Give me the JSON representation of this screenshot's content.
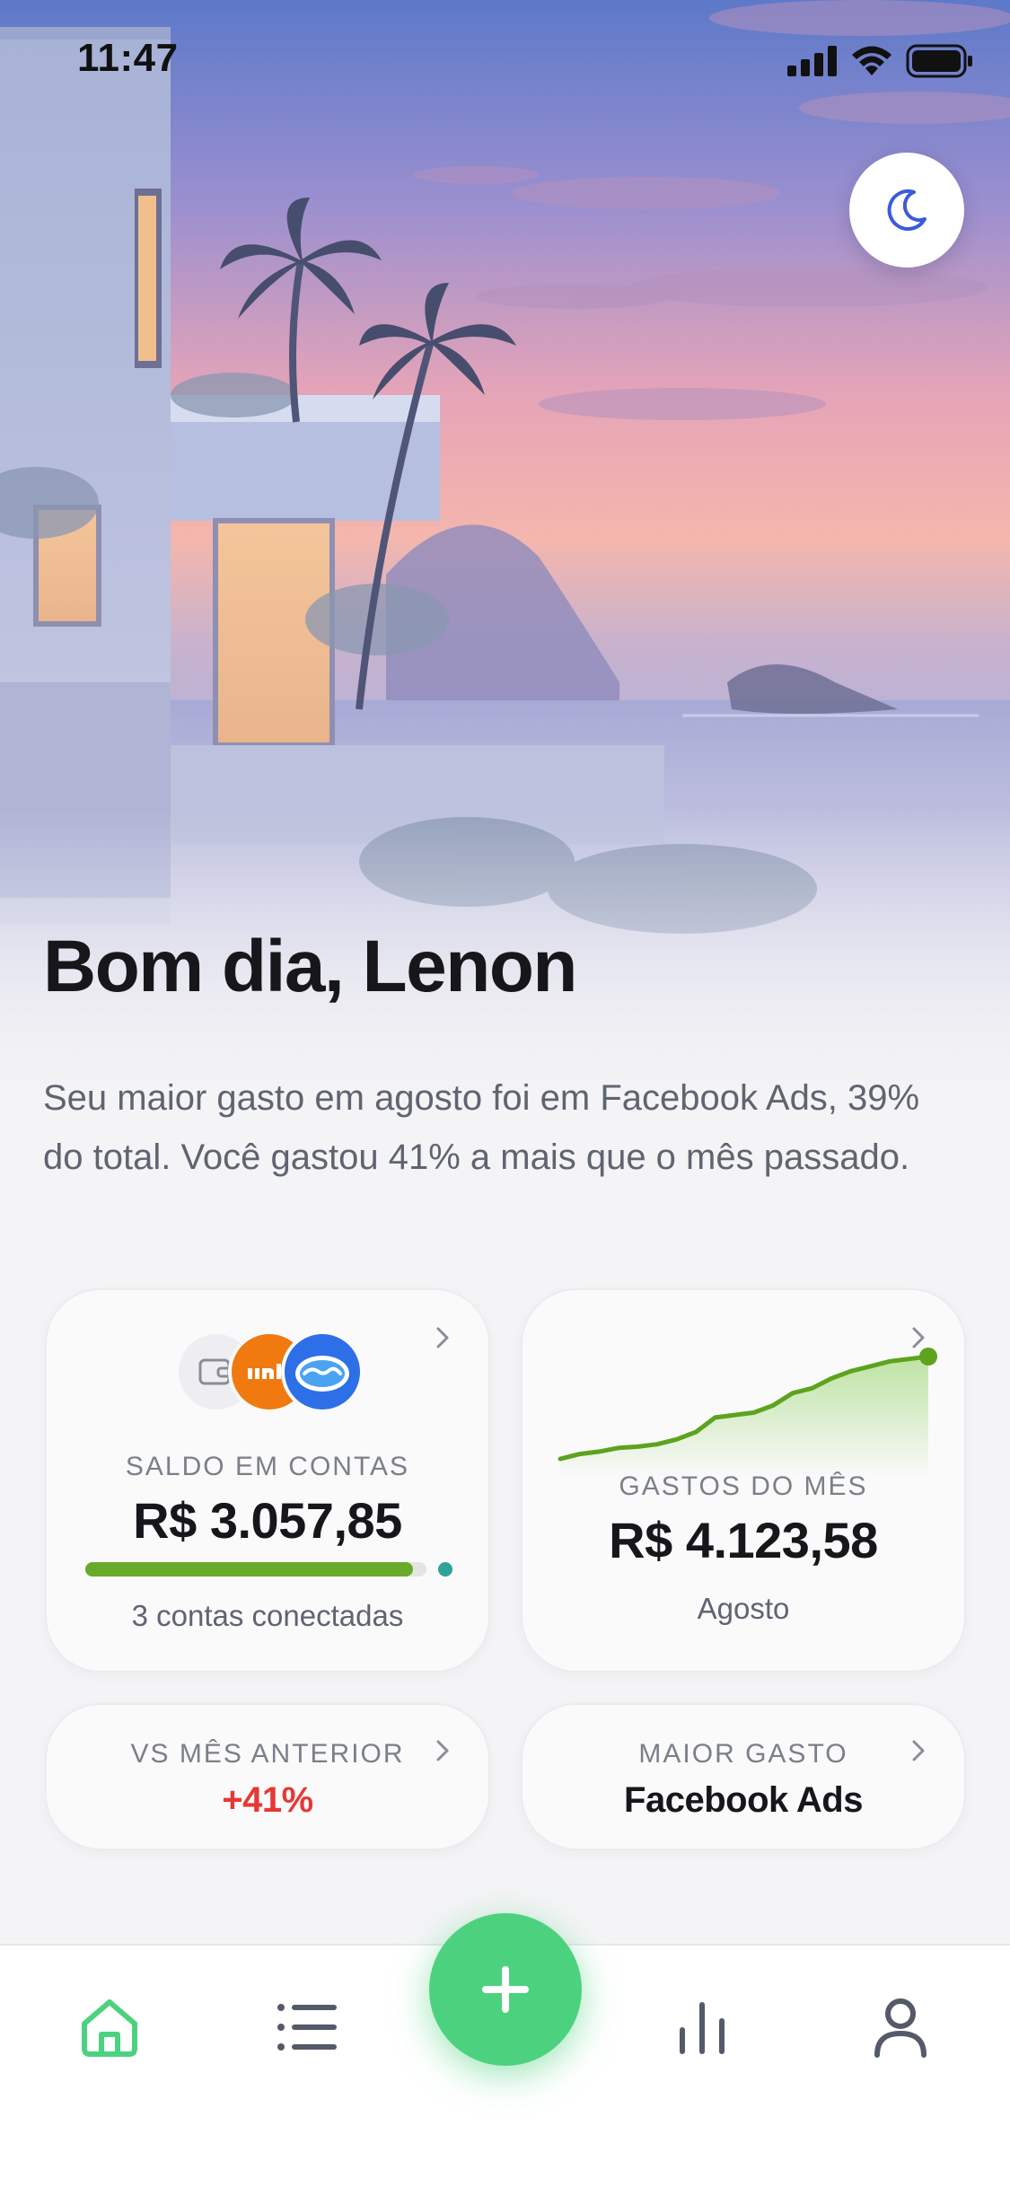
{
  "status_bar": {
    "time": "11:47"
  },
  "greeting": "Bom dia, Lenon",
  "summary": "Seu maior gasto em agosto foi em Facebook Ads, 39% do total. Você gastou 41% a mais que o mês passado.",
  "cards": {
    "saldo": {
      "label": "SALDO EM CONTAS",
      "value": "R$ 3.057,85",
      "sub": "3 contas conectadas",
      "banks": [
        "wallet-icon",
        "inter",
        "mercado-pago"
      ],
      "progress": 0.96
    },
    "gastos": {
      "label": "GASTOS DO MÊS",
      "value": "R$ 4.123,58",
      "sub": "Agosto",
      "sparkline": [
        8,
        12,
        14,
        17,
        18,
        20,
        24,
        30,
        42,
        44,
        46,
        52,
        62,
        66,
        74,
        80,
        84,
        88,
        90,
        92
      ]
    },
    "vs": {
      "label": "VS MÊS ANTERIOR",
      "value": "+41%"
    },
    "maior": {
      "label": "MAIOR GASTO",
      "value": "Facebook Ads"
    }
  },
  "nav": {
    "items": [
      "home-icon",
      "list-icon",
      "add-icon",
      "stats-icon",
      "profile-icon"
    ],
    "active": "home-icon"
  },
  "colors": {
    "accent_green": "#4cd27e",
    "negative_red": "#e53935",
    "progress_green": "#6aaa2a",
    "spark_green": "#5da31e"
  }
}
